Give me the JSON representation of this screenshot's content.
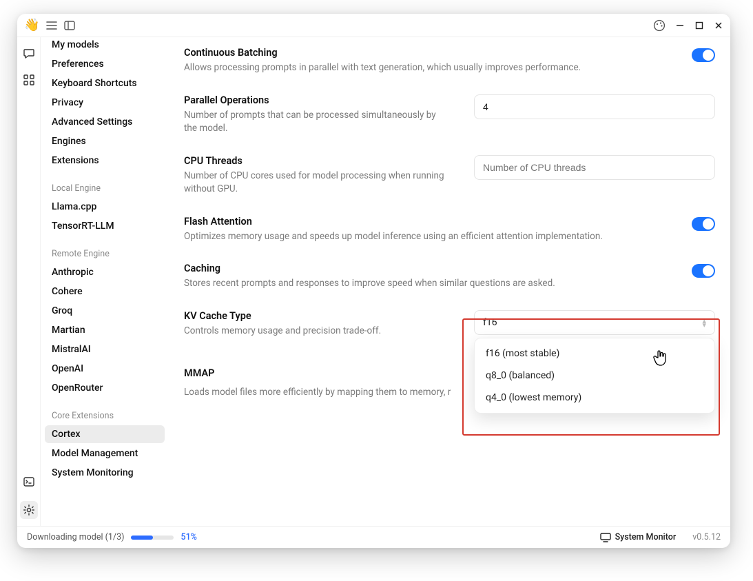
{
  "titlebar": {
    "logo": "👋"
  },
  "sidebar": {
    "top_items": [
      "My models",
      "Preferences",
      "Keyboard Shortcuts",
      "Privacy",
      "Advanced Settings",
      "Engines",
      "Extensions"
    ],
    "local_engine_label": "Local Engine",
    "local_engine_items": [
      "Llama.cpp",
      "TensorRT-LLM"
    ],
    "remote_engine_label": "Remote Engine",
    "remote_engine_items": [
      "Anthropic",
      "Cohere",
      "Groq",
      "Martian",
      "MistralAI",
      "OpenAI",
      "OpenRouter"
    ],
    "core_ext_label": "Core Extensions",
    "core_ext_items": [
      "Cortex",
      "Model Management",
      "System Monitoring"
    ],
    "selected": "Cortex"
  },
  "settings": {
    "continuous_batching": {
      "title": "Continuous Batching",
      "desc": "Allows processing prompts in parallel with text generation, which usually improves performance.",
      "enabled": true
    },
    "parallel_ops": {
      "title": "Parallel Operations",
      "desc": "Number of prompts that can be processed simultaneously by the model.",
      "value": "4"
    },
    "cpu_threads": {
      "title": "CPU Threads",
      "desc": "Number of CPU cores used for model processing when running without GPU.",
      "placeholder": "Number of CPU threads",
      "value": ""
    },
    "flash_attention": {
      "title": "Flash Attention",
      "desc": "Optimizes memory usage and speeds up model inference using an efficient attention implementation.",
      "enabled": true
    },
    "caching": {
      "title": "Caching",
      "desc": "Stores recent prompts and responses to improve speed when similar questions are asked.",
      "enabled": true
    },
    "kv_cache": {
      "title": "KV Cache Type",
      "desc": "Controls memory usage and precision trade-off.",
      "selected": "f16",
      "options": [
        "f16 (most stable)",
        "q8_0 (balanced)",
        "q4_0 (lowest memory)"
      ]
    },
    "mmap": {
      "title": "MMAP",
      "desc": "Loads model files more efficiently by mapping them to memory, r"
    }
  },
  "status": {
    "download_label": "Downloading model (1/3)",
    "percent": "51%",
    "system_monitor": "System Monitor",
    "version": "v0.5.12"
  }
}
